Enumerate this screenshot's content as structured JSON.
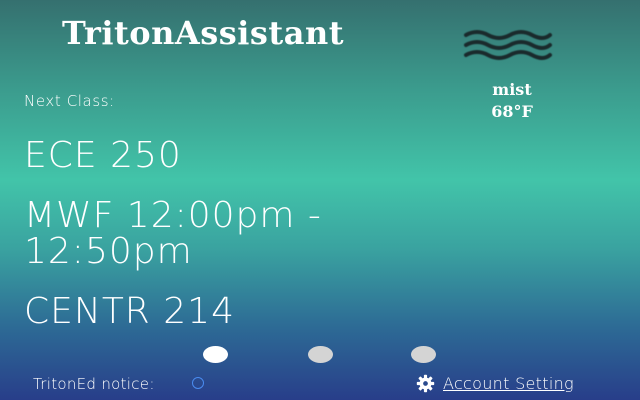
{
  "header": {
    "title": "TritonAssistant"
  },
  "weather": {
    "icon": "fog-waves-icon",
    "description": "mist",
    "temperature": "68°F"
  },
  "next_class": {
    "label": "Next Class:",
    "course": "ECE 250",
    "time_line1": "MWF 12:00pm -",
    "time_line2": "12:50pm",
    "location": "CENTR 214"
  },
  "pagination": {
    "total_pages": 3,
    "active_page": 1
  },
  "footer": {
    "notice_label": "TritonEd notice:",
    "account_label": "Account Setting",
    "account_icon": "gear-icon"
  },
  "colors": {
    "text": "#ffffff",
    "gradient_top": "#35706f",
    "gradient_mid": "#42c4a9",
    "gradient_bottom": "#283e8a",
    "toggle_outline": "#4a8cf0",
    "dot_inactive": "#d4d4d4"
  }
}
